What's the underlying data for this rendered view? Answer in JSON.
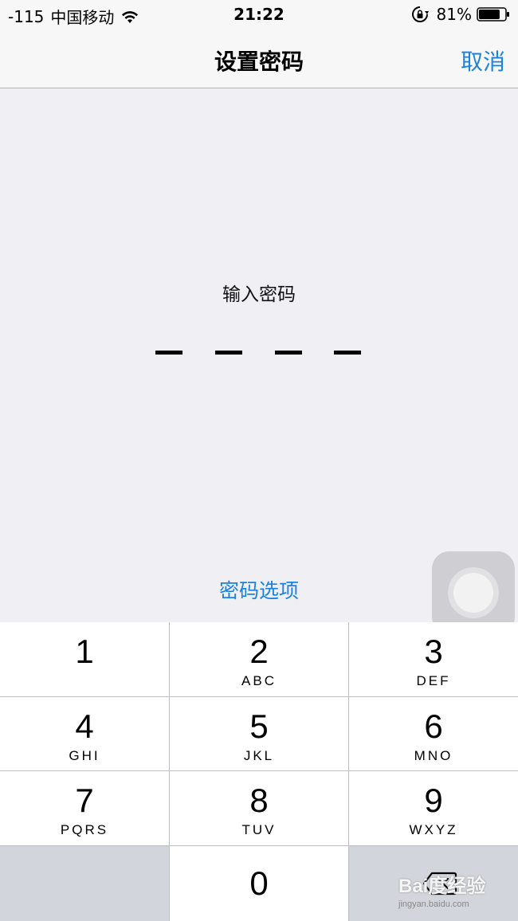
{
  "status_bar": {
    "signal": "-115",
    "carrier": "中国移动",
    "time": "21:22",
    "battery_percent": "81%",
    "battery_level": 0.81
  },
  "nav": {
    "title": "设置密码",
    "cancel": "取消"
  },
  "passcode": {
    "prompt": "输入密码",
    "digits_entered": 0,
    "length": 4,
    "options": "密码选项"
  },
  "keypad": {
    "keys": [
      {
        "num": "1",
        "letters": ""
      },
      {
        "num": "2",
        "letters": "ABC"
      },
      {
        "num": "3",
        "letters": "DEF"
      },
      {
        "num": "4",
        "letters": "GHI"
      },
      {
        "num": "5",
        "letters": "JKL"
      },
      {
        "num": "6",
        "letters": "MNO"
      },
      {
        "num": "7",
        "letters": "PQRS"
      },
      {
        "num": "8",
        "letters": "TUV"
      },
      {
        "num": "9",
        "letters": "WXYZ"
      }
    ],
    "zero": "0"
  },
  "watermark": {
    "main": "Bai度经验",
    "sub": "jingyan.baidu.com"
  },
  "colors": {
    "accent": "#1a82e2",
    "background": "#efeff4",
    "keypad_dark": "#d2d5db"
  }
}
